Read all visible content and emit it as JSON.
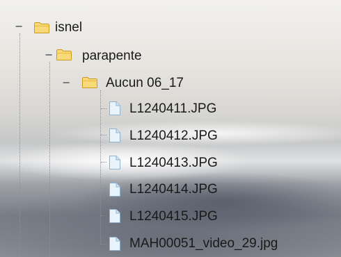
{
  "tree": {
    "root": {
      "label": "isnel",
      "icon": "folder-icon",
      "expanded": true,
      "toggle": "−",
      "child": {
        "label": "parapente",
        "icon": "folder-icon",
        "expanded": true,
        "toggle": "−",
        "child": {
          "label": "Aucun 06_17",
          "icon": "folder-icon",
          "expanded": true,
          "toggle": "−",
          "files": [
            {
              "label": "L1240411.JPG",
              "icon": "file-icon"
            },
            {
              "label": "L1240412.JPG",
              "icon": "file-icon"
            },
            {
              "label": "L1240413.JPG",
              "icon": "file-icon"
            },
            {
              "label": "L1240414.JPG",
              "icon": "file-icon"
            },
            {
              "label": "L1240415.JPG",
              "icon": "file-icon"
            },
            {
              "label": "MAH00051_video_29.jpg",
              "icon": "file-icon"
            }
          ]
        }
      }
    }
  },
  "colors": {
    "folder_fill": "#f9d978",
    "folder_stroke": "#c99a1a",
    "file_fill": "#e9f3fb",
    "file_stroke": "#8fb2d1",
    "connector": "#8e8f92"
  }
}
